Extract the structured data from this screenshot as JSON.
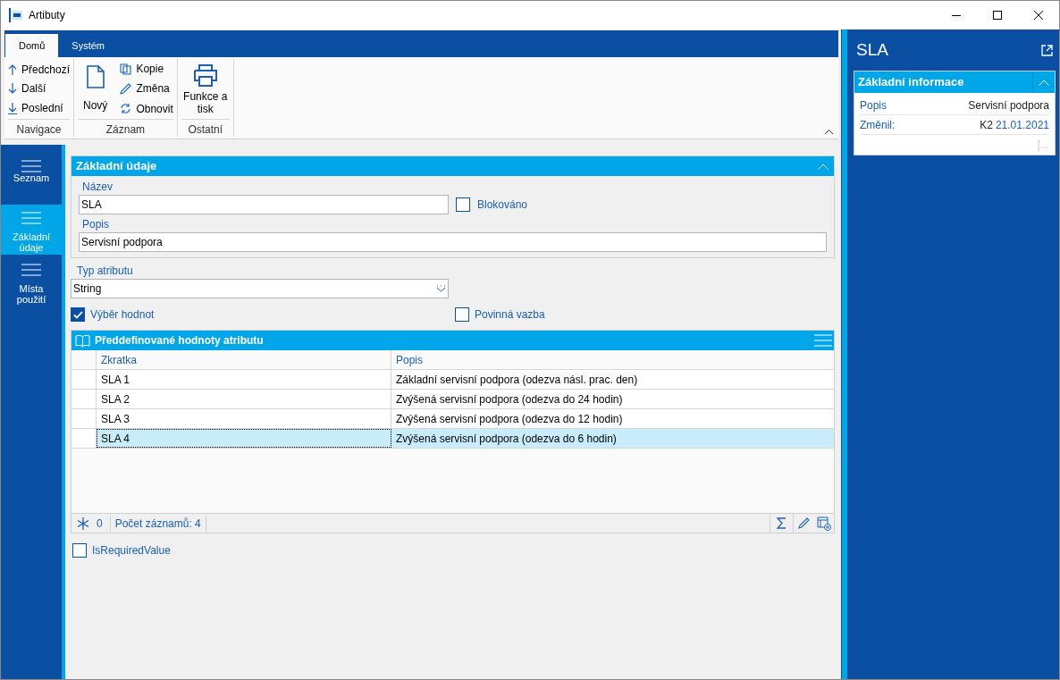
{
  "window": {
    "title": "Artibuty"
  },
  "ribbon_tabs": [
    {
      "label": "Domů",
      "selected": true
    },
    {
      "label": "Systém",
      "selected": false
    }
  ],
  "ribbon_groups": [
    {
      "label": "Navigace",
      "kind": "small",
      "buttons": [
        "Předchozí",
        "Další",
        "Poslední"
      ]
    },
    {
      "label": "Záznam",
      "kind": "mixed",
      "buttons": [
        "Nový",
        "Kopie",
        "Změna",
        "Obnovit"
      ]
    },
    {
      "label": "Ostatní",
      "kind": "large",
      "buttons": [
        "Funkce a tisk"
      ]
    }
  ],
  "nav_items": [
    {
      "label": "Seznam",
      "selected": false
    },
    {
      "label": "Základní údaje",
      "selected": true
    },
    {
      "label": "Místa použití",
      "selected": false
    }
  ],
  "basic_section": {
    "title": "Základní údaje",
    "name_label": "Název",
    "name_value": "SLA",
    "blocked": {
      "label": "Blokováno",
      "checked": false
    },
    "description_label": "Popis",
    "description_value": "Servisní podpora"
  },
  "type_field": {
    "label": "Typ atributu",
    "value": "String"
  },
  "value_selection": {
    "label": "Výběr hodnot",
    "checked": true
  },
  "mandatory_link": {
    "label": "Povinná vazba",
    "checked": false
  },
  "table": {
    "title": "Předdefinované hodnoty atributu",
    "columns": [
      "Zkratka",
      "Popis"
    ],
    "rows": [
      {
        "cells": [
          "SLA 1",
          "Základní servisní podpora (odezva násl. prac. den)"
        ],
        "selected": false
      },
      {
        "cells": [
          "SLA 2",
          "Zvýšená servisní podpora (odezva do 24 hodin)"
        ],
        "selected": false
      },
      {
        "cells": [
          "SLA 3",
          "Zvýšená servisní podpora (odezva do 12 hodin)"
        ],
        "selected": false
      },
      {
        "cells": [
          "SLA 4",
          "Zvýšená servisní podpora (odezva do 6 hodin)"
        ],
        "selected": true
      }
    ],
    "footer_count": "0",
    "footer_records": "Počet záznamů: 4"
  },
  "required_value": {
    "label": "IsRequiredValue",
    "checked": false
  },
  "side_panel": {
    "title": "SLA",
    "section": "Základní informace",
    "rows": [
      {
        "label": "Popis",
        "value": "Servisní podpora"
      },
      {
        "label": "Změnil:",
        "value": "K2",
        "date": "21.01.2021"
      }
    ],
    "more": "[..."
  }
}
